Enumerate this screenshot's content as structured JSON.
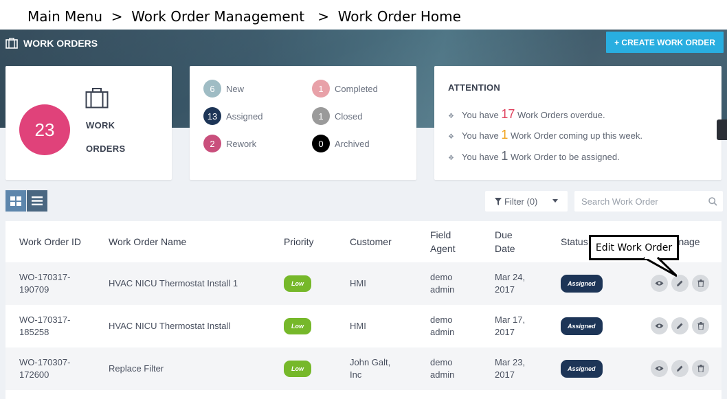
{
  "breadcrumb": {
    "text": "Main Menu  >  Work Order Management   >  Work Order Home"
  },
  "header": {
    "title": "WORK ORDERS",
    "create_label": "+ CREATE WORK ORDER"
  },
  "summary": {
    "total": "23",
    "label_line1": "WORK",
    "label_line2": "ORDERS"
  },
  "stats": [
    {
      "count": "6",
      "label": "New",
      "color": "#9fbcc4"
    },
    {
      "count": "13",
      "label": "Assigned",
      "color": "#1d3557"
    },
    {
      "count": "2",
      "label": "Rework",
      "color": "#c94f7c"
    },
    {
      "count": "1",
      "label": "Completed",
      "color": "#e8a1a8"
    },
    {
      "count": "1",
      "label": "Closed",
      "color": "#9a9a9a"
    },
    {
      "count": "0",
      "label": "Archived",
      "color": "#000000"
    }
  ],
  "attention": {
    "title": "ATTENTION",
    "lines": [
      {
        "pre": "You have ",
        "num": "17",
        "post": " Work Orders overdue.",
        "color": "#e0425e"
      },
      {
        "pre": "You have ",
        "num": "1",
        "post": " Work Order coming up this week.",
        "color": "#f0a21b"
      },
      {
        "pre": "You have ",
        "num": "1",
        "post": " Work Order to be assigned.",
        "color": "#5f6673"
      }
    ]
  },
  "toolbar": {
    "filter_label": "Filter (0)",
    "search_placeholder": "Search Work Order"
  },
  "table": {
    "headers": {
      "id": "Work Order ID",
      "name": "Work Order Name",
      "priority": "Priority",
      "customer": "Customer",
      "agent_l1": "Field",
      "agent_l2": "Agent",
      "due_l1": "Due",
      "due_l2": "Date",
      "status": "Status",
      "manage": "Manage"
    },
    "rows": [
      {
        "id_l1": "WO-170317-",
        "id_l2": "190709",
        "name": "HVAC NICU Thermostat Install 1",
        "priority": "Low",
        "customer_l1": "HMI",
        "customer_l2": "",
        "agent_l1": "demo",
        "agent_l2": "admin",
        "due_l1": "Mar 24,",
        "due_l2": "2017",
        "status": "Assigned"
      },
      {
        "id_l1": "WO-170317-",
        "id_l2": "185258",
        "name": "HVAC NICU Thermostat Install",
        "priority": "Low",
        "customer_l1": "HMI",
        "customer_l2": "",
        "agent_l1": "demo",
        "agent_l2": "admin",
        "due_l1": "Mar 17,",
        "due_l2": "2017",
        "status": "Assigned"
      },
      {
        "id_l1": "WO-170307-",
        "id_l2": "172600",
        "name": "Replace Filter",
        "priority": "Low",
        "customer_l1": "John Galt,",
        "customer_l2": "Inc",
        "agent_l1": "demo",
        "agent_l2": "admin",
        "due_l1": "Mar 23,",
        "due_l2": "2017",
        "status": "Assigned"
      }
    ]
  },
  "callout": {
    "text": "Edit Work Order"
  },
  "icons": {
    "briefcase": "briefcase-icon",
    "grid": "grid-view-icon",
    "list": "list-view-icon",
    "filter": "filter-icon",
    "search": "search-icon",
    "view": "eye-icon",
    "edit": "pencil-icon",
    "delete": "trash-icon"
  }
}
